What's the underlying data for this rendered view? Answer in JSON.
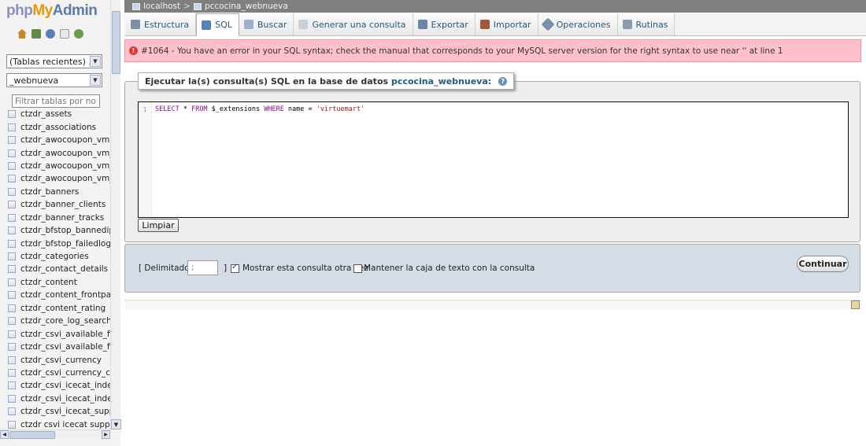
{
  "logo": {
    "php": "php",
    "my": "My",
    "admin_a": "Adm",
    "admin_b": "in"
  },
  "quick_icons": [
    "home-icon",
    "exit-icon",
    "help-icon",
    "docs-icon",
    "reload-icon"
  ],
  "nav": {
    "recent_tables": "(Tablas recientes) ...",
    "database": "_webnueva",
    "filter_placeholder": "Filtrar tablas por nombre",
    "tables": [
      "ctzdr_assets",
      "ctzdr_associations",
      "ctzdr_awocoupon_vm",
      "ctzdr_awocoupon_vm_history",
      "ctzdr_awocoupon_vm_product",
      "ctzdr_awocoupon_vm_user",
      "ctzdr_banners",
      "ctzdr_banner_clients",
      "ctzdr_banner_tracks",
      "ctzdr_bfstop_bannedip",
      "ctzdr_bfstop_failedlogin",
      "ctzdr_categories",
      "ctzdr_contact_details",
      "ctzdr_content",
      "ctzdr_content_frontpage",
      "ctzdr_content_rating",
      "ctzdr_core_log_searches",
      "ctzdr_csvi_available_fields",
      "ctzdr_csvi_available_fields",
      "ctzdr_csvi_currency",
      "ctzdr_csvi_currency_currency",
      "ctzdr_csvi_icecat_index",
      "ctzdr_csvi_icecat_index_d",
      "ctzdr_csvi_icecat_supplier",
      "ctzdr csvi icecat supplier"
    ]
  },
  "breadcrumb": {
    "server": "localhost",
    "separator": ">",
    "database": "pccocina_webnueva"
  },
  "tabs": [
    {
      "label": "Estructura",
      "icon": "structure-icon",
      "active": false
    },
    {
      "label": "SQL",
      "icon": "sql-icon",
      "active": true
    },
    {
      "label": "Buscar",
      "icon": "search-icon",
      "active": false
    },
    {
      "label": "Generar una consulta",
      "icon": "query-icon",
      "active": false
    },
    {
      "label": "Exportar",
      "icon": "export-icon",
      "active": false
    },
    {
      "label": "Importar",
      "icon": "import-icon",
      "active": false
    },
    {
      "label": "Operaciones",
      "icon": "wrench-icon",
      "active": false
    },
    {
      "label": "Rutinas",
      "icon": "routines-icon",
      "active": false
    }
  ],
  "error": {
    "text": "#1064 - You have an error in your SQL syntax; check the manual that corresponds to your MySQL server version for the right syntax to use near '' at line 1"
  },
  "query_panel": {
    "legend": "Ejecutar la(s) consulta(s) SQL en la base de datos",
    "database": "pccocina_webnueva:",
    "line_number": "1",
    "sql": {
      "kw1": "SELECT",
      "p1": " * ",
      "kw2": "FROM",
      "p2": " $_extensions ",
      "kw3": "WHERE",
      "p3": " name = ",
      "str": "'virtuemart'"
    },
    "clear_label": "Limpiar"
  },
  "options": {
    "delimiter_label": "[ Delimitador",
    "delimiter_value": ";",
    "delimiter_close": "]",
    "show_query_label": "Mostrar esta consulta otra vez",
    "show_query_checked": true,
    "keep_box_label": "Mantener la caja de texto con la consulta",
    "keep_box_checked": false,
    "continue_label": "Continuar"
  },
  "colors": {
    "error_bg": "#ffc0cb",
    "error_border": "#ff8da1",
    "link": "#235a81",
    "breadcrumb_bg": "#7f7f7f",
    "options_bg": "#d4dce5"
  }
}
